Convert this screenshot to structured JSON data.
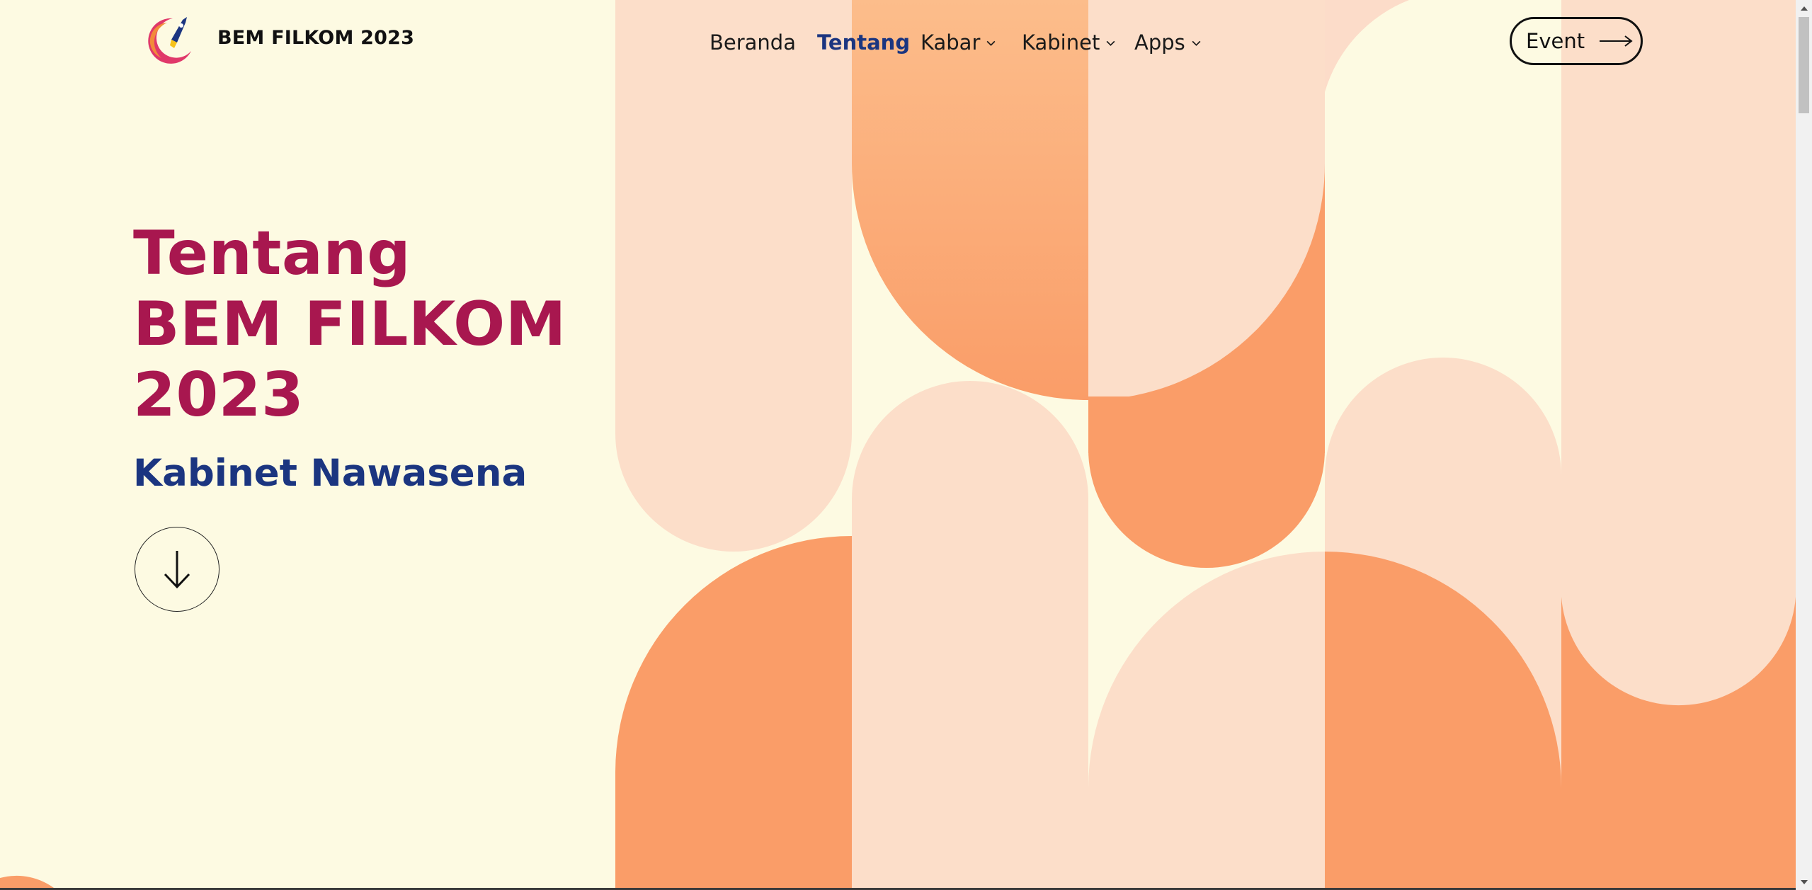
{
  "header": {
    "brand": "BEM FILKOM 2023",
    "nav": [
      {
        "label": "Beranda",
        "dropdown": false,
        "active": false
      },
      {
        "label": "Tentang",
        "dropdown": false,
        "active": true
      },
      {
        "label": "Kabar",
        "dropdown": true,
        "active": false
      },
      {
        "label": "Kabinet",
        "dropdown": true,
        "active": false
      },
      {
        "label": "Apps",
        "dropdown": true,
        "active": false
      }
    ],
    "event_button": {
      "label": "Event",
      "icon": "long-arrow-right-icon"
    }
  },
  "hero": {
    "title_lines": [
      "Tentang",
      "BEM FILKOM",
      "2023"
    ],
    "subtitle": "Kabinet Nawasena",
    "scroll_button_icon": "arrow-down-icon"
  },
  "colors": {
    "background": "#fdfae2",
    "title": "#a8174f",
    "accent_blue": "#1b3580",
    "orange": "#fa9d68",
    "peach": "#fcdec9"
  }
}
